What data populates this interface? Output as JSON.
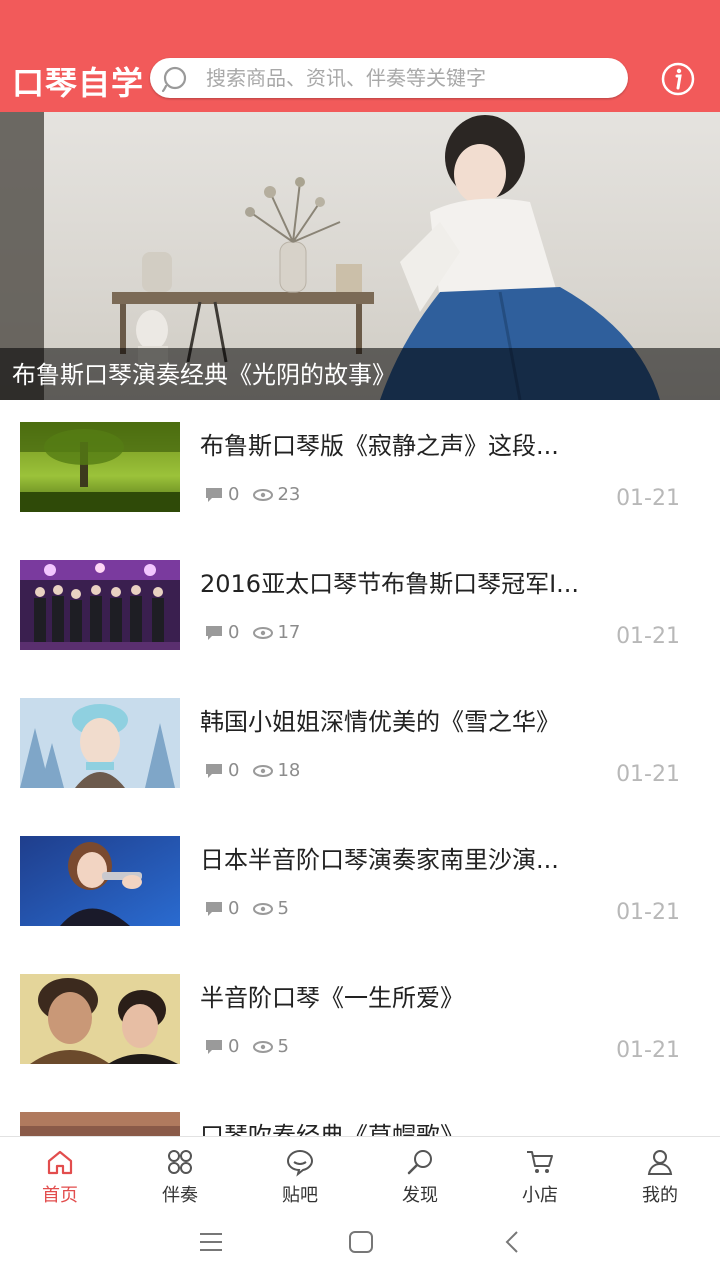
{
  "header": {
    "brand": "口琴自学",
    "search_placeholder": "搜索商品、资讯、伴奏等关键字",
    "accent": "#f25a5a"
  },
  "hero": {
    "caption": "布鲁斯口琴演奏经典《光阴的故事》"
  },
  "articles": [
    {
      "title": " 布鲁斯口琴版《寂静之声》这段...",
      "comments": "0",
      "views": "23",
      "date": "01-21"
    },
    {
      "title": "2016亚太口琴节布鲁斯口琴冠军I...",
      "comments": "0",
      "views": "17",
      "date": "01-21"
    },
    {
      "title": "韩国小姐姐深情优美的《雪之华》",
      "comments": "0",
      "views": "18",
      "date": "01-21"
    },
    {
      "title": "日本半音阶口琴演奏家南里沙演...",
      "comments": "0",
      "views": "5",
      "date": "01-21"
    },
    {
      "title": "半音阶口琴《一生所爱》",
      "comments": "0",
      "views": "5",
      "date": "01-21"
    },
    {
      "title": "口琴吹奏经典《草帽歌》",
      "comments": "",
      "views": "",
      "date": ""
    }
  ],
  "tabbar": {
    "items": [
      {
        "label": "首页",
        "icon": "home-icon"
      },
      {
        "label": "伴奏",
        "icon": "grid-icon"
      },
      {
        "label": "贴吧",
        "icon": "chat-bubble-icon"
      },
      {
        "label": "发现",
        "icon": "magnifier-icon"
      },
      {
        "label": "小店",
        "icon": "cart-icon"
      },
      {
        "label": "我的",
        "icon": "user-icon"
      }
    ],
    "active_color": "#e24d4d"
  }
}
